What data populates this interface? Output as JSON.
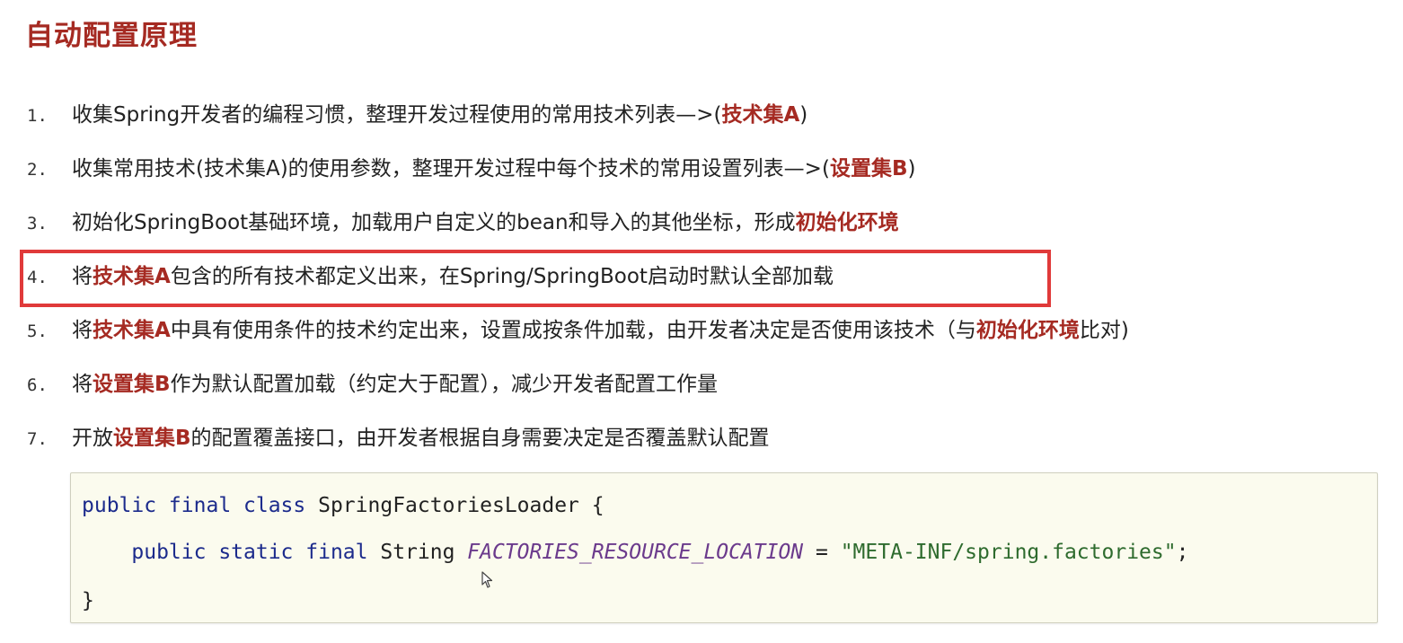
{
  "title": "自动配置原理",
  "colors": {
    "title": "#a52a22",
    "emphasis": "#a52a22",
    "text": "#222222",
    "highlight_border": "#e03a3a",
    "code_bg": "#fbfbee",
    "code_keyword": "#1c2b8c",
    "code_constant": "#6b3a8c",
    "code_string": "#2e6b2e"
  },
  "items": [
    {
      "number": "1.",
      "segments": [
        {
          "text": "收集Spring开发者的编程习惯，整理开发过程使用的常用技术列表—>(",
          "em": false
        },
        {
          "text": "技术集A",
          "em": true
        },
        {
          "text": ")",
          "em": false
        }
      ]
    },
    {
      "number": "2.",
      "segments": [
        {
          "text": "收集常用技术(技术集A)的使用参数，整理开发过程中每个技术的常用设置列表—>(",
          "em": false
        },
        {
          "text": "设置集B",
          "em": true
        },
        {
          "text": ")",
          "em": false
        }
      ]
    },
    {
      "number": "3.",
      "segments": [
        {
          "text": "初始化SpringBoot基础环境，加载用户自定义的bean和导入的其他坐标，形成",
          "em": false
        },
        {
          "text": "初始化环境",
          "em": true
        }
      ]
    },
    {
      "number": "4.",
      "segments": [
        {
          "text": "将",
          "em": false
        },
        {
          "text": "技术集A",
          "em": true
        },
        {
          "text": "包含的所有技术都定义出来，在Spring/SpringBoot启动时默认全部加载",
          "em": false
        }
      ]
    },
    {
      "number": "5.",
      "segments": [
        {
          "text": "将",
          "em": false
        },
        {
          "text": "技术集A",
          "em": true
        },
        {
          "text": "中具有使用条件的技术约定出来，设置成按条件加载，由开发者决定是否使用该技术（与",
          "em": false
        },
        {
          "text": "初始化环境",
          "em": true
        },
        {
          "text": "比对)",
          "em": false
        }
      ]
    },
    {
      "number": "6.",
      "segments": [
        {
          "text": "将",
          "em": false
        },
        {
          "text": "设置集B",
          "em": true
        },
        {
          "text": "作为默认配置加载（约定大于配置），减少开发者配置工作量",
          "em": false
        }
      ]
    },
    {
      "number": "7.",
      "segments": [
        {
          "text": "开放",
          "em": false
        },
        {
          "text": "设置集B",
          "em": true
        },
        {
          "text": "的配置覆盖接口，由开发者根据自身需要决定是否覆盖默认配置",
          "em": false
        }
      ]
    }
  ],
  "code": {
    "lines": [
      [
        {
          "text": "public final class ",
          "type": "keyword"
        },
        {
          "text": "SpringFactoriesLoader {",
          "type": "plain"
        }
      ],
      [
        {
          "text": "    public static final ",
          "type": "keyword"
        },
        {
          "text": "String ",
          "type": "plain"
        },
        {
          "text": "FACTORIES_RESOURCE_LOCATION",
          "type": "constant"
        },
        {
          "text": " = ",
          "type": "plain"
        },
        {
          "text": "\"META-INF/spring.factories\"",
          "type": "string"
        },
        {
          "text": ";",
          "type": "plain"
        }
      ],
      [
        {
          "text": "}",
          "type": "plain"
        }
      ]
    ]
  },
  "pointer_icon": "mouse-cursor-icon"
}
